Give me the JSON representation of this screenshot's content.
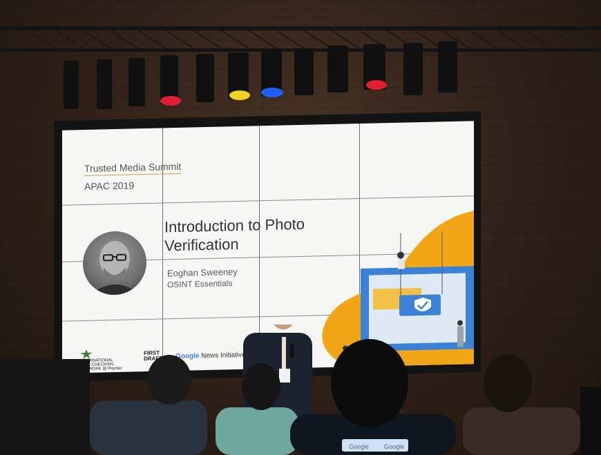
{
  "slide": {
    "event_title": "Trusted Media Summit",
    "event_year": "APAC 2019",
    "talk_title_line1": "Introduction to Photo",
    "talk_title_line2": "Verification",
    "speaker_name": "Eoghan Sweeney",
    "speaker_org": "OSINT Essentials",
    "logo_ifcn_line1": "INTERNATIONAL",
    "logo_ifcn_line2": "FACT-CHECKING",
    "logo_ifcn_line3": "NETWORK @ Poynter",
    "logo_firstdraft_line1": "FIRST",
    "logo_firstdraft_line2": "DRAFT",
    "logo_google": "Google",
    "logo_news_initiative": " News Initiative"
  },
  "lights": [
    {
      "color": "#e02030"
    },
    {
      "color": "#f0d020"
    },
    {
      "color": "#2060f0"
    },
    {
      "color": "#e02030"
    }
  ],
  "colors": {
    "accent_orange": "#f2a516",
    "accent_blue": "#3b82d6"
  },
  "icons": [
    "shield-check-icon",
    "spotlight-icon"
  ],
  "badges": {
    "lanyard_left": "Google",
    "lanyard_right": "Google"
  }
}
